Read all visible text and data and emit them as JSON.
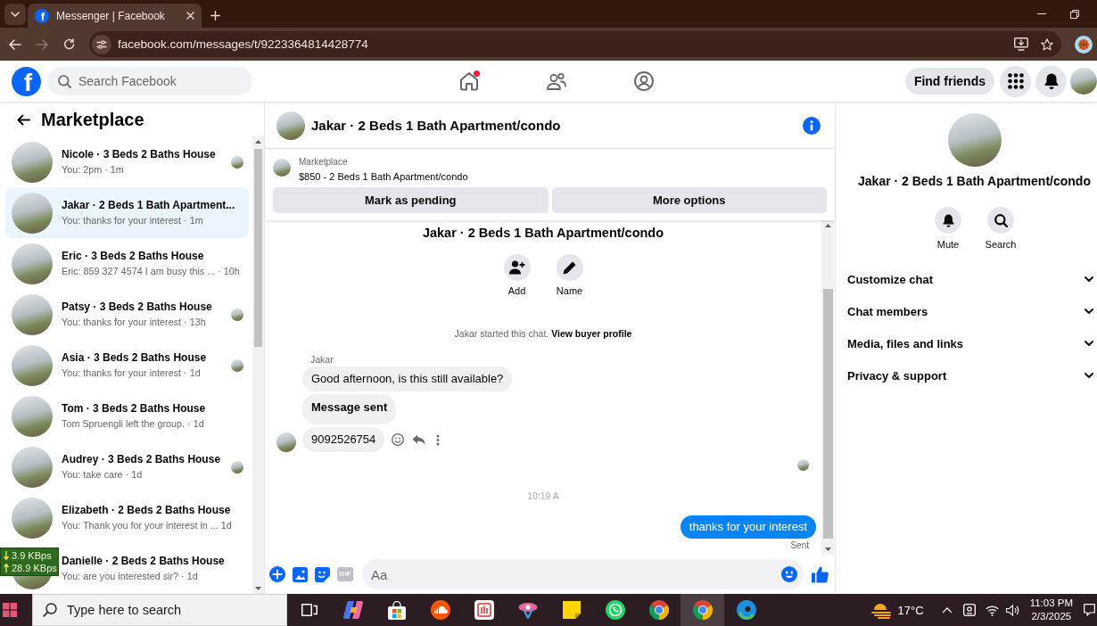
{
  "browser": {
    "tab": {
      "favicon": "f",
      "title": "Messenger | Facebook",
      "selected": true
    },
    "nav_buttons": [
      {
        "kind": "back",
        "disabled": false
      },
      {
        "kind": "forward",
        "disabled": true
      },
      {
        "kind": "reload",
        "disabled": false
      }
    ],
    "url": "facebook.com/messages/t/9223364814428774"
  },
  "header": {
    "logo": "f",
    "search": {
      "placeholder": "Search Facebook"
    },
    "nav": [
      {
        "kind": "home",
        "selected": false,
        "badge": true
      },
      {
        "kind": "friends",
        "selected": false,
        "badge": false
      },
      {
        "kind": "groups",
        "selected": false,
        "badge": false
      }
    ],
    "find_friends": "Find friends",
    "buttons": [
      {
        "kind": "menu"
      },
      {
        "kind": "notifications"
      }
    ]
  },
  "sidebar": {
    "title": "Marketplace",
    "conversations": [
      {
        "name": "Nicole · 3 Beds 2 Baths House",
        "preview": "You: 2pm · 1m",
        "selected": false,
        "seen": true
      },
      {
        "name": "Jakar · 2 Beds 1 Bath Apartment...",
        "preview": "You: thanks for your interest · 1m",
        "selected": true,
        "seen": false
      },
      {
        "name": "Eric · 3 Beds 2 Baths House",
        "preview": "Eric: 859 327 4574 I am busy this ... · 10h",
        "selected": false,
        "seen": false
      },
      {
        "name": "Patsy · 3 Beds 2 Baths House",
        "preview": "You: thanks for your interest · 13h",
        "selected": false,
        "seen": true
      },
      {
        "name": "Asia · 3 Beds 2 Baths House",
        "preview": "You: thanks for your interest · 1d",
        "selected": false,
        "seen": true
      },
      {
        "name": "Tom · 3 Beds 2 Baths House",
        "preview": "Tom Spruengli left the group. · 1d",
        "selected": false,
        "seen": false
      },
      {
        "name": "Audrey · 3 Beds 2 Baths House",
        "preview": "You: take care · 1d",
        "selected": false,
        "seen": true
      },
      {
        "name": "Elizabeth · 2 Beds 2 Baths House",
        "preview": "You: Thank you for your interest in ... 1d",
        "selected": false,
        "seen": false
      },
      {
        "name": "Danielle · 2 Beds 2 Baths House",
        "preview": "You: are you interested sir? · 1d",
        "selected": false,
        "seen": false
      }
    ]
  },
  "chat": {
    "title": "Jakar · 2 Beds 1 Bath Apartment/condo",
    "listing": {
      "source": "Marketplace",
      "summary": "$850 - 2 Beds 1 Bath Apartment/condo",
      "buttons": [
        "Mark as pending",
        "More options"
      ]
    },
    "intro": {
      "title": "Jakar · 2 Beds 1 Bath Apartment/condo",
      "actions": [
        {
          "kind": "add",
          "label": "Add"
        },
        {
          "kind": "rename",
          "label": "Name"
        }
      ],
      "notice": "Jakar started this chat.",
      "notice_link": "View buyer profile"
    },
    "messages": [
      {
        "kind": "sender",
        "text": "Jakar"
      },
      {
        "kind": "incoming",
        "text": "Good afternoon, is this still available?",
        "bold": false,
        "avatar": false,
        "actions": false
      },
      {
        "kind": "incoming",
        "text": "Message sent",
        "bold": true,
        "avatar": false,
        "actions": false
      },
      {
        "kind": "incoming",
        "text": "9092526754",
        "bold": false,
        "avatar": true,
        "actions": true
      },
      {
        "kind": "seen"
      },
      {
        "kind": "timestamp",
        "text": "10:19 A"
      },
      {
        "kind": "outgoing",
        "text": "thanks for your interest",
        "status": "Sent"
      }
    ],
    "composer": {
      "tools": [
        {
          "kind": "plus"
        },
        {
          "kind": "image"
        },
        {
          "kind": "sticker"
        },
        {
          "kind": "gif",
          "label": "GIF"
        }
      ],
      "placeholder": "Aa"
    }
  },
  "details": {
    "title": "Jakar · 2 Beds 1 Bath Apartment/condo",
    "actions": [
      {
        "kind": "mute",
        "label": "Mute"
      },
      {
        "kind": "search",
        "label": "Search"
      }
    ],
    "sections": [
      {
        "label": "Customize chat",
        "expanded": false
      },
      {
        "label": "Chat members",
        "expanded": false
      },
      {
        "label": "Media, files and links",
        "expanded": false
      },
      {
        "label": "Privacy & support",
        "expanded": false
      }
    ]
  },
  "netspeed": {
    "download": "3.9 KBps",
    "upload": "28.9 KBps"
  },
  "taskbar": {
    "search": {
      "placeholder": "Type here to search"
    },
    "apps": [
      {
        "kind": "taskview",
        "active": false
      },
      {
        "kind": "copilot",
        "active": false
      },
      {
        "kind": "store",
        "active": false
      },
      {
        "kind": "soundcloud",
        "active": false
      },
      {
        "kind": "redtile",
        "active": false
      },
      {
        "kind": "ribbon",
        "active": false
      },
      {
        "kind": "notes",
        "active": false
      },
      {
        "kind": "whatsapp",
        "active": false
      },
      {
        "kind": "chrome",
        "active": false
      },
      {
        "kind": "chrome",
        "active": true
      },
      {
        "kind": "edge",
        "active": false
      }
    ],
    "weather": "17°C",
    "time": "11:03 PM",
    "date": "2/3/2025"
  }
}
